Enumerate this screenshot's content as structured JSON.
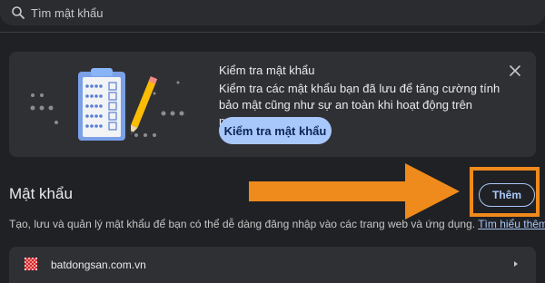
{
  "search": {
    "placeholder": "Tìm mật khẩu",
    "icon": "search-icon"
  },
  "checkup_card": {
    "title": "Kiểm tra mật khẩu",
    "description": "Kiểm tra các mật khẩu bạn đã lưu để tăng cường tính bảo mật cũng như sự an toàn khi hoạt động trên mạng",
    "button_label": "Kiểm tra mật khẩu",
    "illustration": "password-checklist-illustration",
    "close_icon": "close-icon"
  },
  "passwords_section": {
    "title": "Mật khẩu",
    "add_button_label": "Thêm",
    "description": "Tạo, lưu và quản lý mật khẩu để bạn có thể dễ dàng đăng nhập vào các trang web và ứng dụng.",
    "learn_more_label": "Tìm hiểu thêm"
  },
  "saved_sites": [
    {
      "name": "batdongsan.com.vn",
      "favicon": "batdongsan-logo"
    }
  ],
  "colors": {
    "background": "#202124",
    "card": "#2f3034",
    "accent": "#a8c7fa",
    "annotation": "#ef8a1c"
  }
}
